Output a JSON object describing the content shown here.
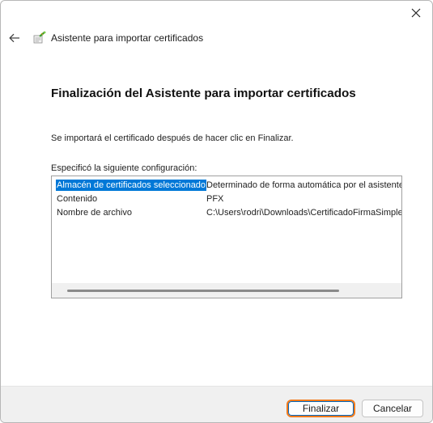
{
  "window": {
    "close_icon": "close-icon"
  },
  "header": {
    "back_icon": "arrow-left-icon",
    "wizard_icon": "certificate-wizard-icon",
    "title": "Asistente para importar certificados"
  },
  "main": {
    "heading": "Finalización del Asistente para importar certificados",
    "intro": "Se importará el certificado después de hacer clic en Finalizar.",
    "settings_label": "Especificó la siguiente configuración:",
    "settings": [
      {
        "key": "Almacén de certificados seleccionado",
        "value": "Determinado de forma automática por el asistente",
        "selected": true
      },
      {
        "key": "Contenido",
        "value": "PFX",
        "selected": false
      },
      {
        "key": "Nombre de archivo",
        "value": "C:\\Users\\rodri\\Downloads\\CertificadoFirmaSimple",
        "selected": false
      }
    ]
  },
  "footer": {
    "finish_label": "Finalizar",
    "cancel_label": "Cancelar"
  },
  "colors": {
    "selection": "#0078d7",
    "highlight_outline": "#f27a1a",
    "footer_bg": "#f0f0f0"
  }
}
